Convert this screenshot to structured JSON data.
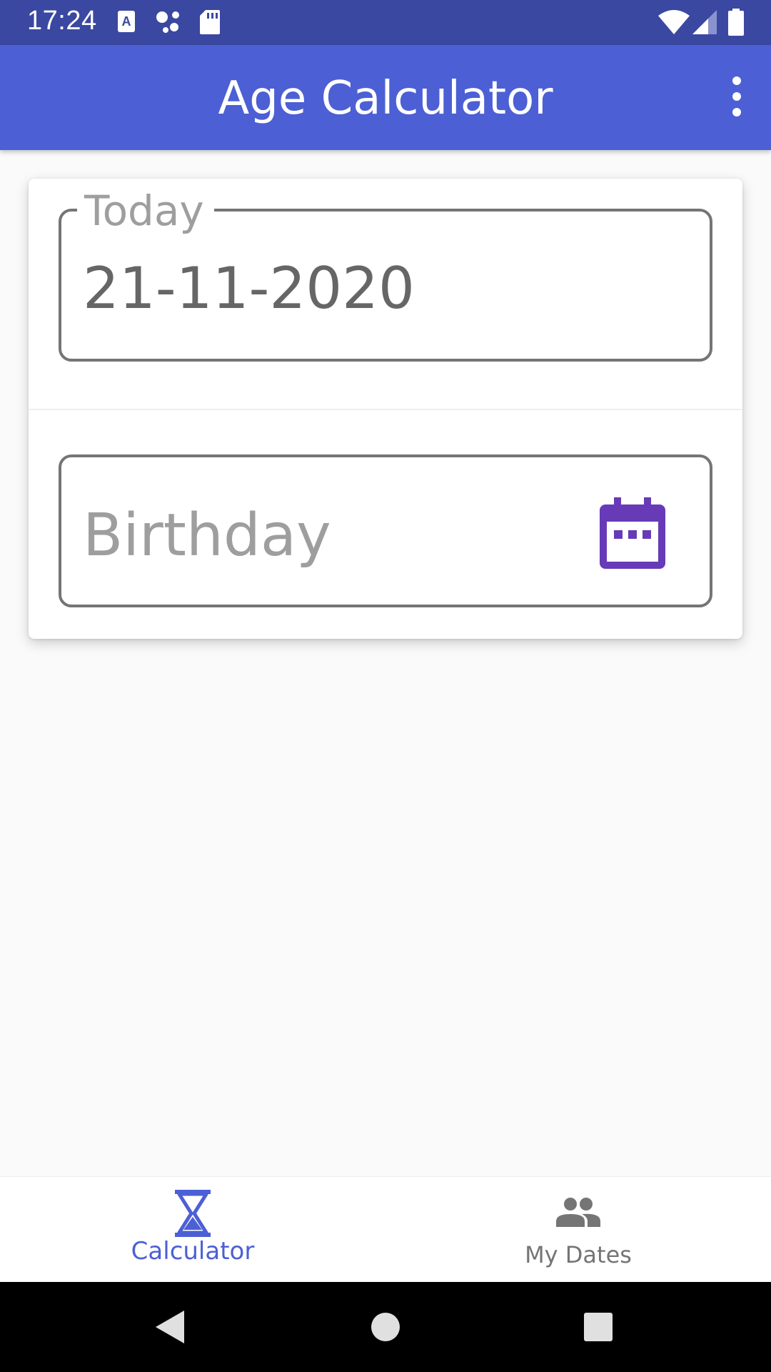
{
  "status_bar": {
    "time": "17:24",
    "icons": [
      "a-notification-icon",
      "assistant-dots-icon",
      "sd-card-icon",
      "wifi-icon",
      "cell-signal-icon",
      "battery-icon"
    ]
  },
  "app_bar": {
    "title": "Age Calculator",
    "menu_icon": "more-vert-icon"
  },
  "form": {
    "today": {
      "label": "Today",
      "value": "21-11-2020"
    },
    "birthday": {
      "placeholder": "Birthday",
      "icon": "calendar-icon"
    }
  },
  "bottom_nav": {
    "items": [
      {
        "label": "Calculator",
        "icon": "hourglass-icon",
        "active": true
      },
      {
        "label": "My Dates",
        "icon": "people-icon",
        "active": false
      }
    ]
  },
  "system_nav": {
    "buttons": [
      "back-icon",
      "home-icon",
      "recents-icon"
    ]
  },
  "colors": {
    "status_bar": "#3b48a1",
    "app_bar": "#4c5fd5",
    "accent_purple": "#673ab7",
    "active_nav": "#4c5fd5",
    "inactive_nav": "#757575"
  }
}
